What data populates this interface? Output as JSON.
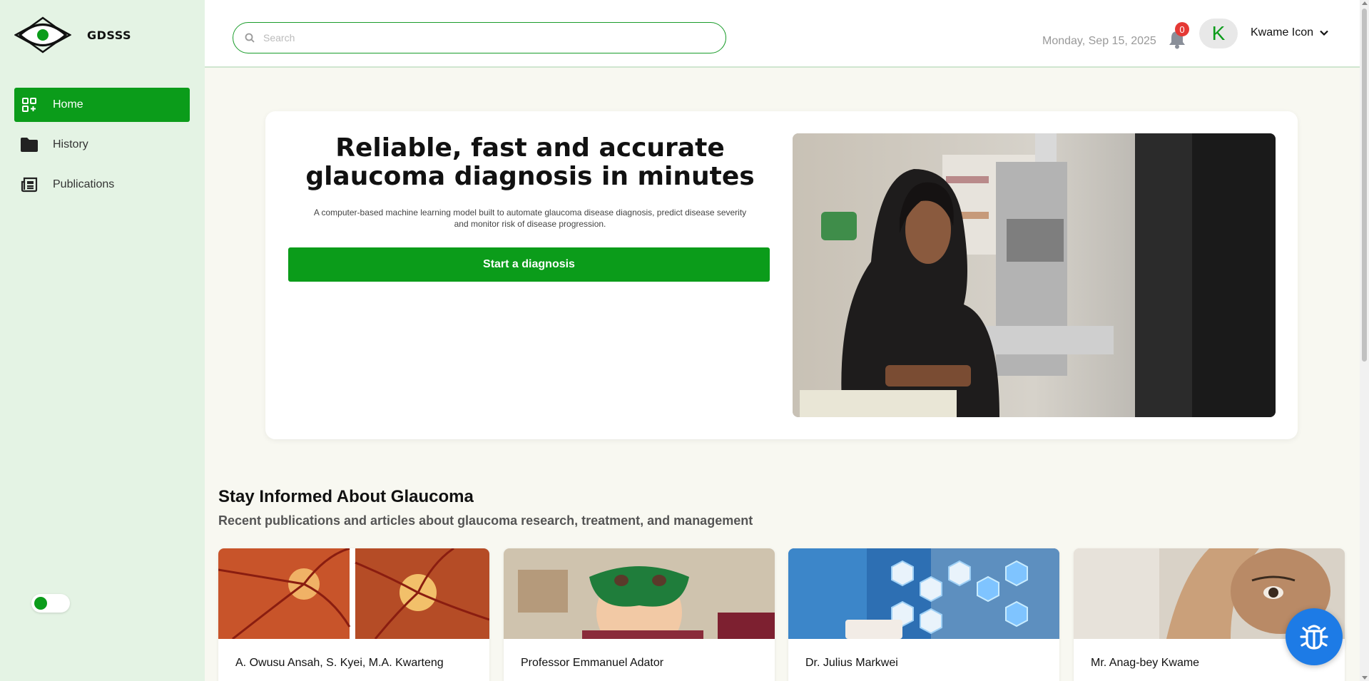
{
  "brand": {
    "name": "GDSSS",
    "accent": "#0b9c1a"
  },
  "sidebar": {
    "items": [
      {
        "label": "Home",
        "icon": "dashboard-add-icon",
        "active": true
      },
      {
        "label": "History",
        "icon": "folder-icon",
        "active": false
      },
      {
        "label": "Publications",
        "icon": "newspaper-icon",
        "active": false
      }
    ],
    "theme_toggle": {
      "on": true
    }
  },
  "header": {
    "search_placeholder": "Search",
    "date": "Monday, Sep 15, 2025",
    "notifications_count": "0",
    "avatar_initial": "K",
    "user_name": "Kwame Icon"
  },
  "hero": {
    "title": "Reliable, fast and accurate glaucoma diagnosis in minutes",
    "subtitle": "A computer-based machine learning model built to automate glaucoma disease diagnosis, predict disease severity and monitor risk of disease progression.",
    "cta": "Start a diagnosis"
  },
  "publications": {
    "title": "Stay Informed About Glaucoma",
    "subtitle": "Recent publications and articles about glaucoma research, treatment, and management",
    "cards": [
      {
        "author": "A. Owusu Ansah, S. Kyei, M.A. Kwarteng"
      },
      {
        "author": "Professor Emmanuel Adator"
      },
      {
        "author": "Dr. Julius Markwei"
      },
      {
        "author": "Mr. Anag-bey Kwame"
      }
    ]
  }
}
